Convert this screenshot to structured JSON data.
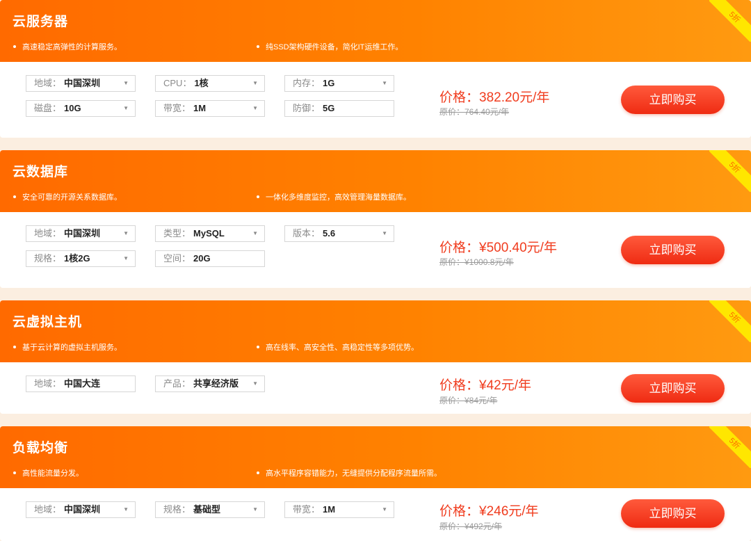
{
  "products": [
    {
      "title": "云服务器",
      "badge": "5折",
      "features": [
        "高速稳定高弹性的计算服务。",
        "纯SSD架构硬件设备，简化IT运维工作。"
      ],
      "fields": [
        {
          "label": "地域：",
          "value": "中国深圳",
          "dropdown": true
        },
        {
          "label": "CPU：",
          "value": "1核",
          "dropdown": true
        },
        {
          "label": "内存：",
          "value": "1G",
          "dropdown": true
        },
        {
          "label": "磁盘：",
          "value": "10G",
          "dropdown": true
        },
        {
          "label": "带宽：",
          "value": "1M",
          "dropdown": true
        },
        {
          "label": "防御：",
          "value": "5G",
          "dropdown": false
        }
      ],
      "price": "价格：382.20元/年",
      "original_price": "原价：764.40元/年",
      "buy_label": "立即购买"
    },
    {
      "title": "云数据库",
      "badge": "5折",
      "features": [
        "安全可靠的开源关系数据库。",
        "一体化多维度监控，高效管理海量数据库。"
      ],
      "fields": [
        {
          "label": "地域：",
          "value": "中国深圳",
          "dropdown": true
        },
        {
          "label": "类型：",
          "value": "MySQL",
          "dropdown": true
        },
        {
          "label": "版本：",
          "value": "5.6",
          "dropdown": true
        },
        {
          "label": "规格：",
          "value": "1核2G",
          "dropdown": true
        },
        {
          "label": "空间：",
          "value": "20G",
          "dropdown": false
        }
      ],
      "price": "价格：¥500.40元/年",
      "original_price": "原价：¥1000.8元/年",
      "buy_label": "立即购买"
    },
    {
      "title": "云虚拟主机",
      "badge": "5折",
      "features": [
        "基于云计算的虚拟主机服务。",
        "高在线率、高安全性、高稳定性等多项优势。"
      ],
      "fields": [
        {
          "label": "地域：",
          "value": "中国大连",
          "dropdown": false
        },
        {
          "label": "产品：",
          "value": "共享经济版",
          "dropdown": true
        }
      ],
      "price": "价格：¥42元/年",
      "original_price": "原价：¥84元/年",
      "buy_label": "立即购买"
    },
    {
      "title": "负载均衡",
      "badge": "5折",
      "features": [
        "高性能流量分发。",
        "高水平程序容错能力，无缝提供分配程序流量所需。"
      ],
      "fields": [
        {
          "label": "地域：",
          "value": "中国深圳",
          "dropdown": true
        },
        {
          "label": "规格：",
          "value": "基础型",
          "dropdown": true
        },
        {
          "label": "带宽：",
          "value": "1M",
          "dropdown": true
        }
      ],
      "price": "价格：¥246元/年",
      "original_price": "原价：¥492元/年",
      "buy_label": "立即购买"
    }
  ],
  "colors": {
    "header_gradient_start": "#ff6a00",
    "header_gradient_end": "#ff9a10",
    "price_red": "#f03c1e",
    "badge_yellow": "#ffe600",
    "button_red": "#ef2b12"
  }
}
